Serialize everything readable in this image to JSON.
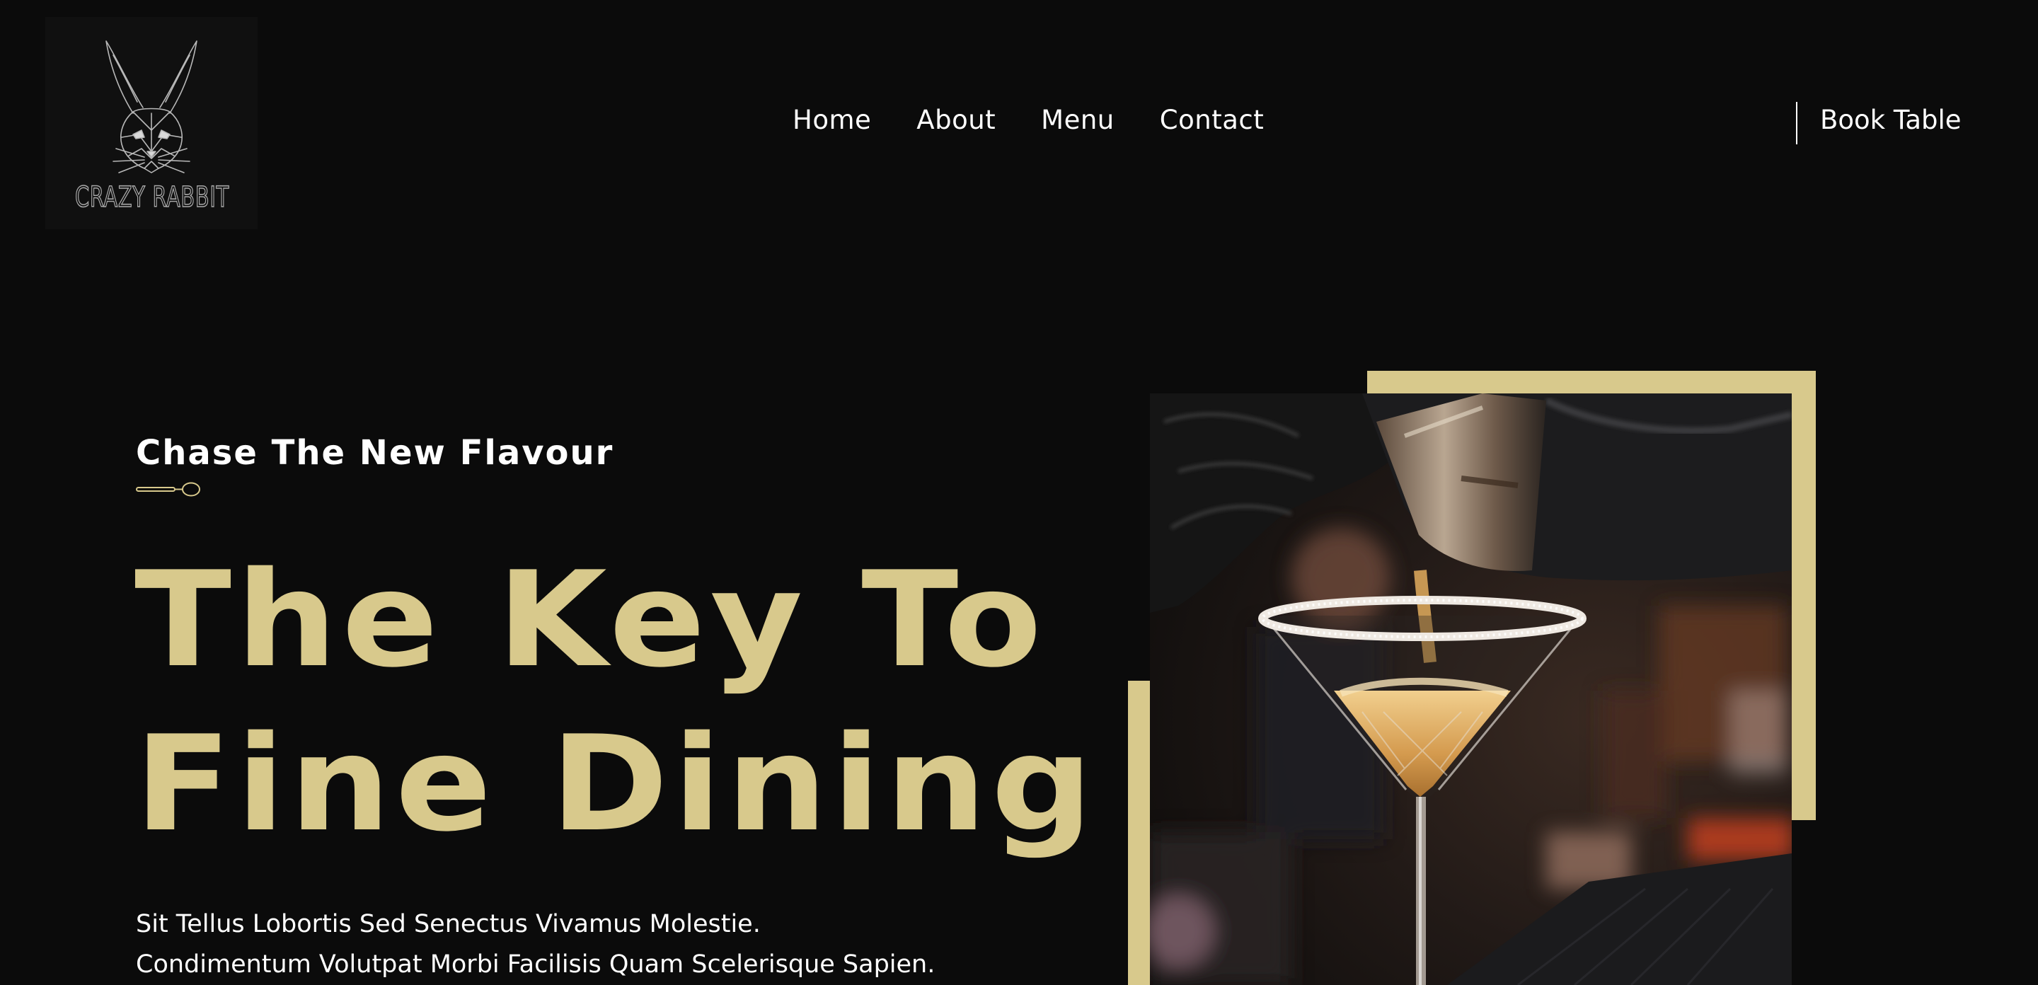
{
  "brand": {
    "name": "CRAZY RABBIT",
    "logo_icon": "rabbit-head-icon"
  },
  "nav": {
    "items": [
      {
        "label": "Home"
      },
      {
        "label": "About"
      },
      {
        "label": "Menu"
      },
      {
        "label": "Contact"
      }
    ],
    "cta_label": "Book Table"
  },
  "hero": {
    "eyebrow": "Chase The New Flavour",
    "divider_icon": "spoon-icon",
    "headline_line1": "The Key To",
    "headline_line2": "Fine Dining",
    "body_line1": "Sit Tellus Lobortis Sed Senectus Vivamus Molestie.",
    "body_line2": "Condimentum Volutpat Morbi Facilisis Quam Scelerisque Sapien.",
    "image_subject": "bartender pouring cocktail into sugar-rimmed martini glass"
  },
  "colors": {
    "background": "#0b0b0b",
    "accent_gold": "#d8c98c",
    "text": "#ffffff",
    "logo_panel": "#101010"
  }
}
